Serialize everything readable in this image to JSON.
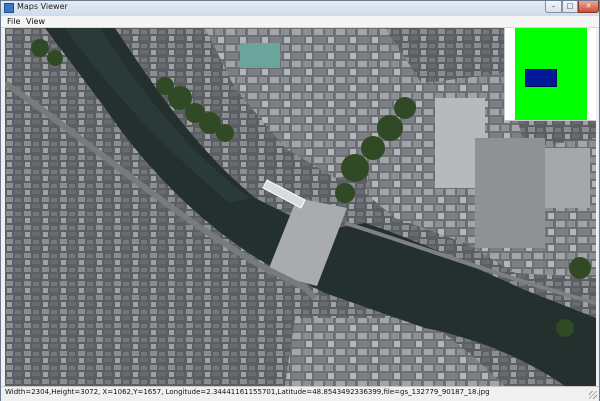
{
  "window": {
    "title": "Maps Viewer",
    "controls": {
      "minimize": "–",
      "maximize": "□",
      "close": "✕"
    },
    "icon": "app-icon"
  },
  "menu": {
    "items": [
      {
        "label": "File"
      },
      {
        "label": "View"
      }
    ]
  },
  "minimap": {
    "world_color": "#00ff00",
    "viewport_color": "#001a99",
    "background_color": "#ffffff"
  },
  "map": {
    "description_icon": "aerial-imagery"
  },
  "status": {
    "text": "Width=2304,Height=3072, X=1062,Y=1657, Longitude=2.34441161155701,Latitude=48.8543492336399,file=gs_132779_90187_18.jpg"
  }
}
